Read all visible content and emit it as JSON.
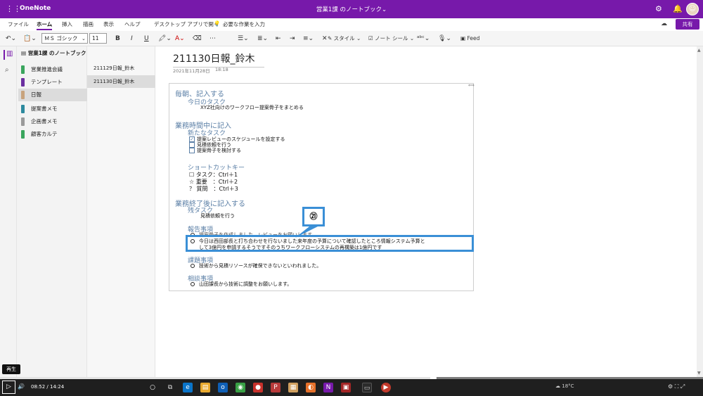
{
  "titlebar": {
    "waffle": "⋮⋮",
    "app_name": "OneNote",
    "notebook_title": "営業1課 のノートブック⌄",
    "icons": [
      "gear-icon",
      "bell-icon",
      "avatar"
    ]
  },
  "menu": {
    "items": [
      "ファイル",
      "ホーム",
      "挿入",
      "描画",
      "表示",
      "ヘルプ",
      "デスクトップ アプリで開く",
      "必要な作業を入力"
    ],
    "active": "ホーム",
    "share_label": "共有"
  },
  "toolbar": {
    "font_name": "ＭＳ ゴシック",
    "font_size": "11",
    "bold": "B",
    "italic": "I",
    "underline": "U",
    "style_label": "スタイル",
    "note_tag_label": "ノート シール",
    "feed_label": "Feed"
  },
  "notebook": {
    "name": "営業1課 のノートブック",
    "sections": [
      {
        "label": "営業推進会議",
        "color": "#3aa55d"
      },
      {
        "label": "テンプレート",
        "color": "#6b2fa0"
      },
      {
        "label": "日報",
        "color": "#c8a37c"
      },
      {
        "label": "提案書メモ",
        "color": "#2d8a9e"
      },
      {
        "label": "企画書メモ",
        "color": "#9a9a9a"
      },
      {
        "label": "顧客カルテ",
        "color": "#3aa55d"
      }
    ],
    "active_section": 2,
    "pages": [
      "211129日報_鈴木",
      "211130日報_鈴木"
    ],
    "active_page": 1
  },
  "page": {
    "title": "211130日報_鈴木",
    "date": "2021年11月28日",
    "time": "18:18",
    "content": {
      "morning_heading": "毎朝、記入する",
      "today_task_heading": "今日のタスク",
      "today_task": "XYZ社向けのワークフロー提案骨子をまとめる",
      "during_heading": "業務時間中に記入",
      "new_task_heading": "新たなタスク",
      "new_tasks": [
        {
          "text": "提案レビューのスケジュールを設定する",
          "checked": true
        },
        {
          "text": "見積依頼を行う",
          "checked": false
        },
        {
          "text": "提案骨子を検討する",
          "checked": false
        }
      ],
      "shortcut_heading": "ショートカットキー",
      "shortcuts": [
        {
          "icon": "☐",
          "text": "タスク：Ctrl＋1"
        },
        {
          "icon": "☆",
          "text": "重要　：Ctrl＋2"
        },
        {
          "icon": "？",
          "text": "質問　：Ctrl＋3"
        }
      ],
      "after_heading": "業務終了後に記入する",
      "remaining_heading": "残タスク",
      "remaining_task": "見積依頼を行う",
      "report_heading": "報告事項",
      "report_items": [
        "提案骨子を作成しました。レビューをお願いします。",
        "今日は西田部長と打ち合わせを行ないました来年度の予算について確認したところ情報システム予算と",
        "して3億円を申請するそうですそのうちワークフローシステムの再構築は1億円です"
      ],
      "issue_heading": "課題事項",
      "issue_item": "技術から見積リソースが確保できないといわれました。",
      "consult_heading": "相談事項",
      "consult_item": "山田課長から技術に調整をお願いします。"
    }
  },
  "callout": {
    "label": "㉑"
  },
  "player": {
    "tooltip": "再生",
    "current_time": "08:52",
    "separator": "/",
    "duration": "14:24",
    "progress": 0.616
  },
  "taskbar": {
    "weather": "18°C"
  }
}
